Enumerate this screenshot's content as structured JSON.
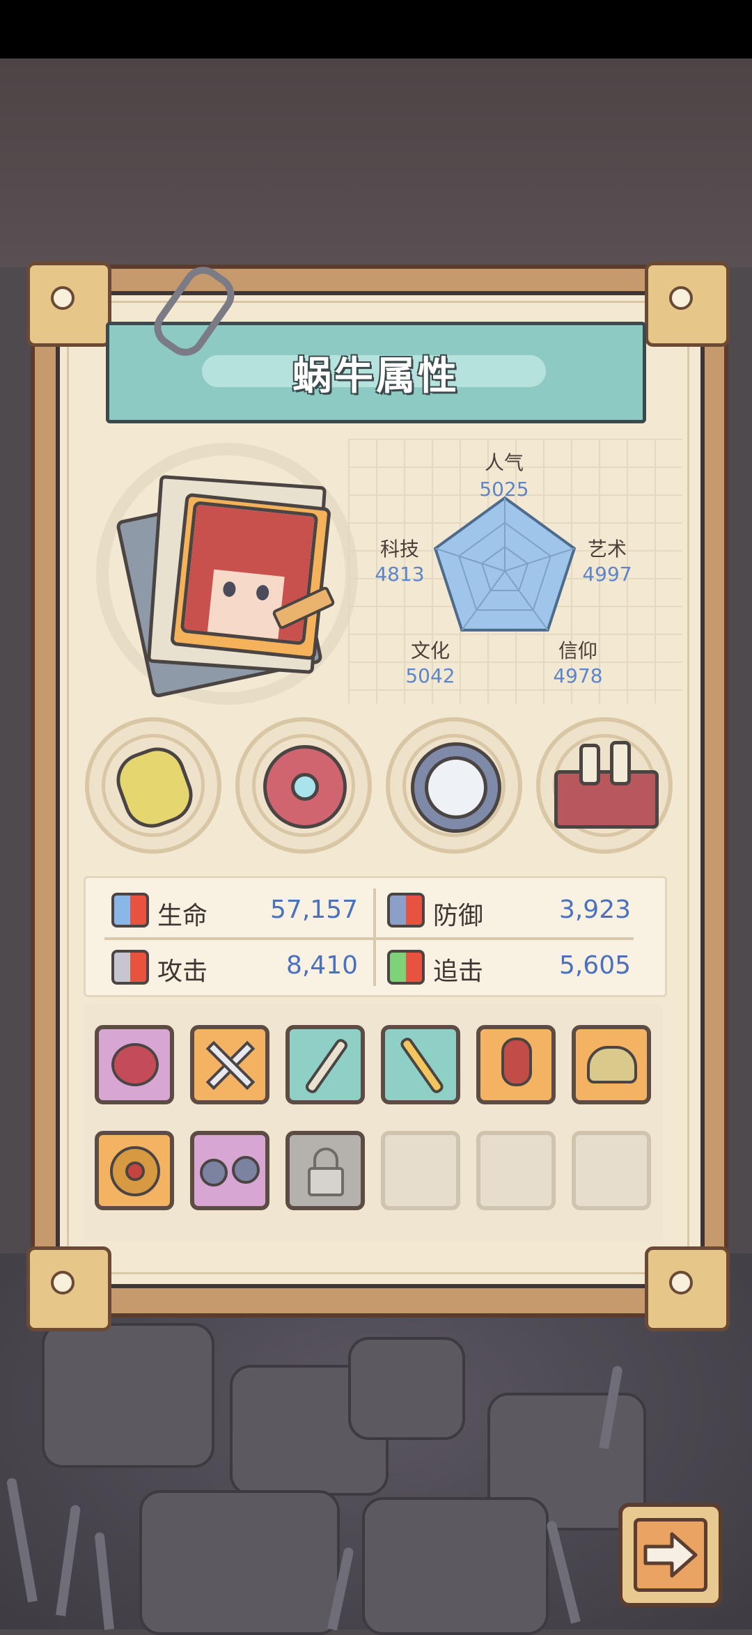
{
  "title": "蜗牛属性",
  "radar": {
    "stats": [
      {
        "label": "人气",
        "value": "5025"
      },
      {
        "label": "艺术",
        "value": "4997"
      },
      {
        "label": "信仰",
        "value": "4978"
      },
      {
        "label": "文化",
        "value": "5042"
      },
      {
        "label": "科技",
        "value": "4813"
      }
    ],
    "fill_color": "#9fc5ea",
    "value_color": "#5d86c9"
  },
  "relics": [
    {
      "icon": "tentacle-relic-icon"
    },
    {
      "icon": "shell-scroll-icon"
    },
    {
      "icon": "compass-icon"
    },
    {
      "icon": "potion-crate-icon"
    }
  ],
  "attributes": {
    "hp": {
      "label": "生命",
      "value": "57,157",
      "icon": "hp-icon"
    },
    "defense": {
      "label": "防御",
      "value": "3,923",
      "icon": "shield-icon"
    },
    "attack": {
      "label": "攻击",
      "value": "8,410",
      "icon": "sword-icon"
    },
    "pursuit": {
      "label": "追击",
      "value": "5,605",
      "icon": "pursuit-icon"
    }
  },
  "equipment": {
    "row1": [
      {
        "icon": "chain-weapon-icon",
        "rarity": "pink"
      },
      {
        "icon": "crossed-swords-icon",
        "rarity": "orange"
      },
      {
        "icon": "horn-staff-icon",
        "rarity": "teal"
      },
      {
        "icon": "blade-icon",
        "rarity": "teal"
      },
      {
        "icon": "armor-icon",
        "rarity": "orange"
      },
      {
        "icon": "winged-helmet-icon",
        "rarity": "orange"
      }
    ],
    "row2": [
      {
        "icon": "ring-icon",
        "rarity": "orange"
      },
      {
        "icon": "goggles-icon",
        "rarity": "pink"
      },
      {
        "icon": "lock-icon",
        "rarity": "locked"
      },
      {
        "icon": "",
        "rarity": "empty"
      },
      {
        "icon": "",
        "rarity": "empty"
      },
      {
        "icon": "",
        "rarity": "empty"
      }
    ]
  },
  "next_button": {
    "icon": "arrow-right-icon"
  }
}
